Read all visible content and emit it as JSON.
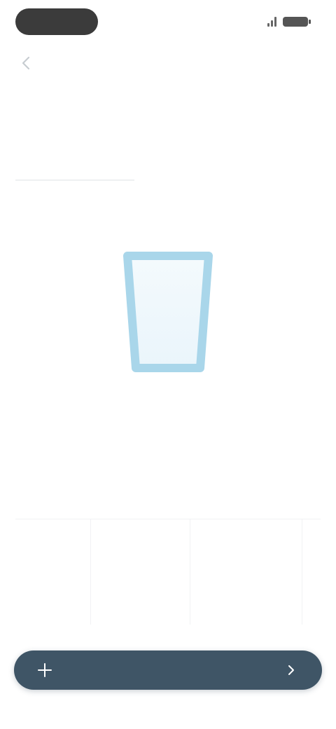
{
  "status_bar": {
    "time": "",
    "icons": [
      "signal-icon",
      "battery-icon"
    ]
  },
  "nav": {
    "title": "",
    "back_icon": "chevron-left-icon"
  },
  "header": {
    "title": "",
    "subtitle": ""
  },
  "tracker": {
    "icon": "water-glass-icon",
    "amount": "",
    "goal": "",
    "fill_fraction": 0.0,
    "accent": "#a9d6ea"
  },
  "history": {
    "columns": [
      {
        "value": ""
      },
      {
        "value": ""
      },
      {
        "value": ""
      }
    ]
  },
  "primary_button": {
    "label": "",
    "color": "#3f5566"
  }
}
